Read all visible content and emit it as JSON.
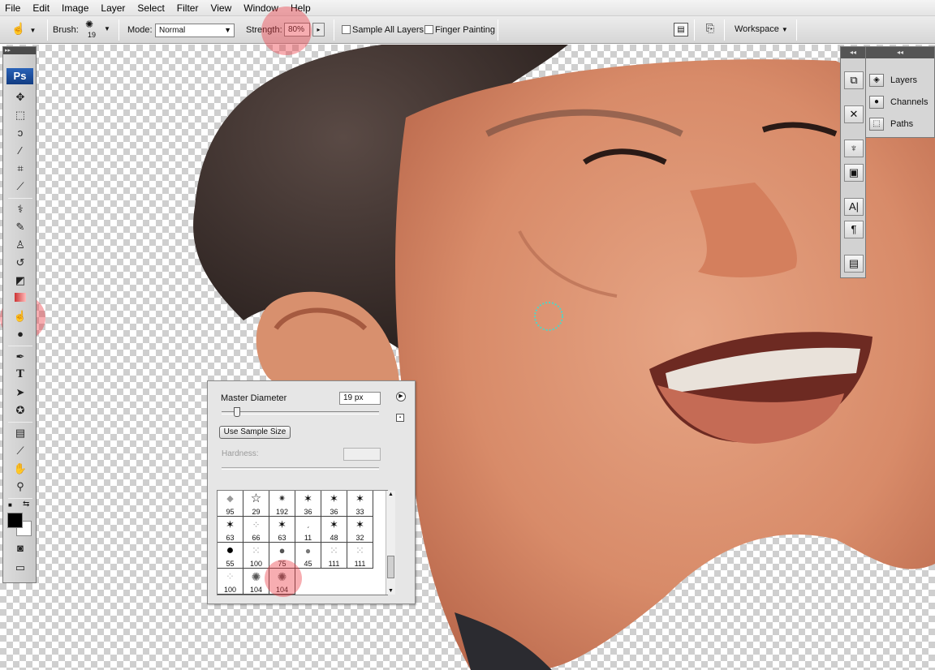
{
  "menu": [
    "File",
    "Edit",
    "Image",
    "Layer",
    "Select",
    "Filter",
    "View",
    "Window",
    "Help"
  ],
  "options_bar": {
    "brush_label": "Brush:",
    "brush_size": "19",
    "mode_label": "Mode:",
    "mode_value": "Normal",
    "strength_label": "Strength:",
    "strength_value": "80%",
    "sample_all_layers": "Sample All Layers",
    "finger_painting": "Finger Painting",
    "workspace": "Workspace"
  },
  "toolbox": {
    "logo": "Ps",
    "text_tool": "T"
  },
  "brush_picker": {
    "master_diameter_label": "Master Diameter",
    "master_diameter_value": "19 px",
    "use_sample_size": "Use Sample Size",
    "hardness_label": "Hardness:",
    "brush_sizes": [
      "95",
      "29",
      "192",
      "36",
      "36",
      "33",
      "63",
      "66",
      "63",
      "11",
      "48",
      "32",
      "55",
      "100",
      "75",
      "45",
      "111",
      "111",
      "100",
      "104",
      "104"
    ],
    "master_diameter_fraction": 0.08
  },
  "panels": {
    "layers": "Layers",
    "channels": "Channels",
    "paths": "Paths"
  },
  "colors": {
    "highlight": "#ec3c46",
    "skin": "#d98a6a",
    "hair": "#3b2f2b"
  },
  "icons": [
    "smudge-tool-icon",
    "move-tool-icon",
    "marquee-tool-icon",
    "lasso-tool-icon",
    "magic-wand-icon",
    "crop-tool-icon",
    "eyedropper-icon",
    "healing-brush-icon",
    "brush-tool-icon",
    "clone-stamp-icon",
    "history-brush-icon",
    "eraser-icon",
    "gradient-icon",
    "blur-tool-icon",
    "dodge-tool-icon",
    "pen-tool-icon",
    "type-tool-icon",
    "path-select-icon",
    "custom-shape-icon",
    "notes-icon",
    "eyedropper-icon",
    "hand-tool-icon",
    "zoom-tool-icon",
    "layers-icon",
    "channels-icon",
    "paths-icon"
  ]
}
